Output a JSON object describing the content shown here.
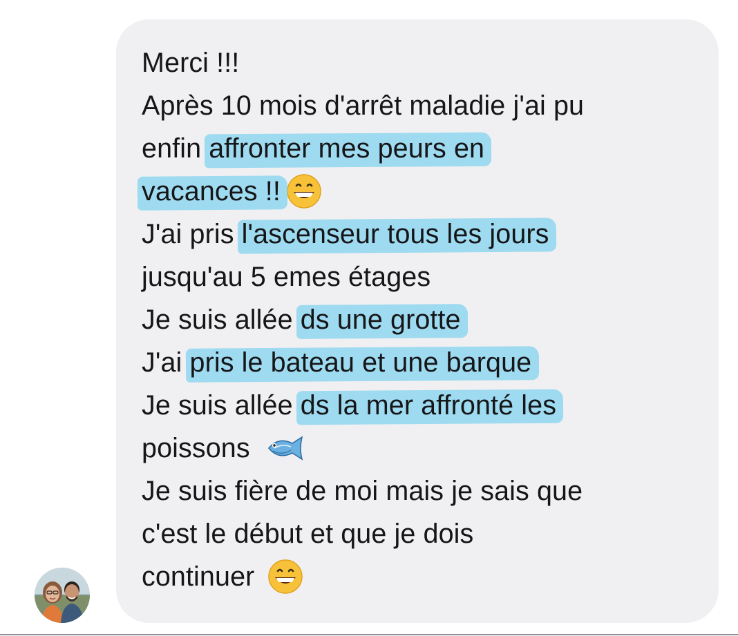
{
  "message": {
    "lines": [
      {
        "pre": "Merci !!!"
      },
      {
        "pre": "Après 10 mois d'arrêt maladie j'ai pu"
      },
      {
        "pre": "enfin ",
        "hl": "affronter mes peurs en"
      },
      {
        "hl": "vacances !!",
        "emoji": "grinning-face-icon"
      },
      {
        "pre": "J'ai pris ",
        "hl": "l'ascenseur tous les jours"
      },
      {
        "pre": "jusqu'au 5 emes étages"
      },
      {
        "pre": "Je suis allée ",
        "hl": "ds une grotte"
      },
      {
        "pre": "J'ai ",
        "hl": "pris le bateau et une barque"
      },
      {
        "pre": "Je suis allée ",
        "hl": "ds la mer affronté les"
      },
      {
        "pre": "poissons ",
        "emoji": "fish-icon"
      },
      {
        "pre": "Je suis fière de moi mais je sais que"
      },
      {
        "pre": "c'est le début et que je dois"
      },
      {
        "pre": "continuer ",
        "emoji": "grinning-face-icon"
      }
    ]
  },
  "colors": {
    "bubble": "#f0f0f2",
    "highlight": "#8fd6f0",
    "text": "#161618"
  },
  "sender": {
    "avatar_icon": "profile-photo-avatar"
  }
}
